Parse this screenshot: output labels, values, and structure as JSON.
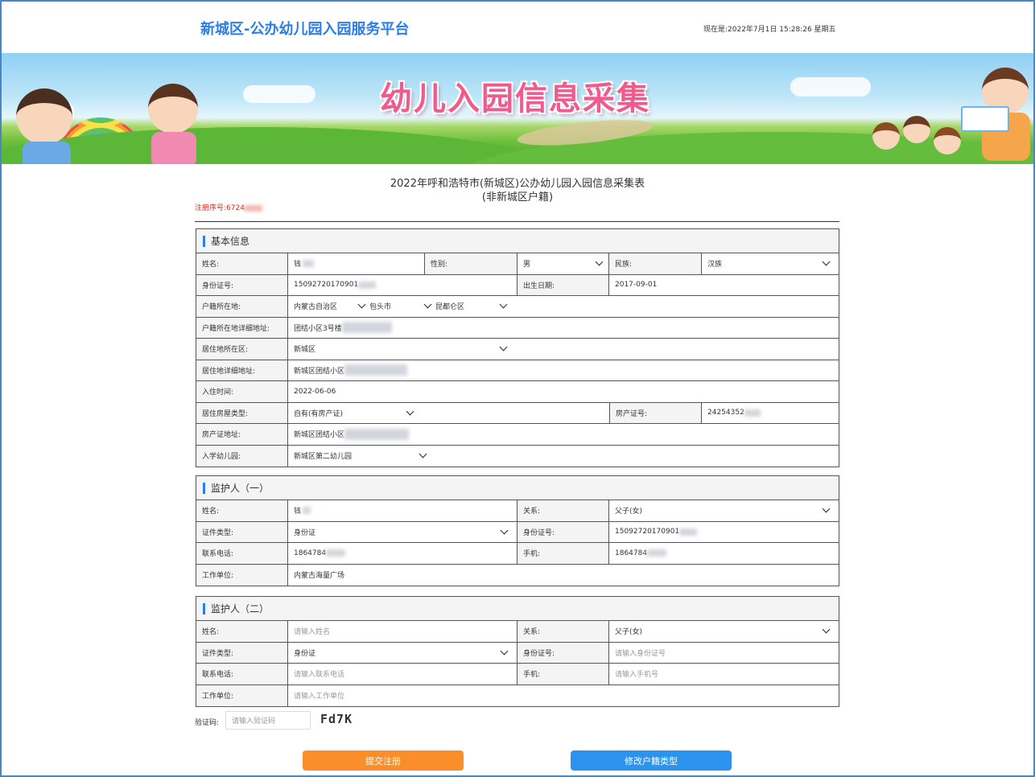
{
  "header": {
    "site_title": "新城区-公办幼儿园入园服务平台",
    "clock": "现在是:2022年7月1日 15:28:26 星期五"
  },
  "banner": {
    "title": "幼儿入园信息采集"
  },
  "form": {
    "title_line1": "2022年呼和浩特市(新城区)公办幼儿园入园信息采集表",
    "title_line2": "(非新城区户籍)",
    "reg_label": "注册序号:6724"
  },
  "basic": {
    "heading": "基本信息",
    "name_label": "姓名:",
    "name_value": "钱",
    "gender_label": "性别:",
    "gender_value": "男",
    "ethnic_label": "民族:",
    "ethnic_value": "汉族",
    "id_label": "身份证号:",
    "id_value": "15092720170901",
    "birth_label": "出生日期:",
    "birth_value": "2017-09-01",
    "hukou_label": "户籍所在地:",
    "hukou_province": "内蒙古自治区",
    "hukou_city": "包头市",
    "hukou_district": "昆都仑区",
    "hukou_addr_label": "户籍所在地详细地址:",
    "hukou_addr_value": "团结小区3号楼",
    "resid_district_label": "居住地所在区:",
    "resid_district_value": "新城区",
    "resid_addr_label": "居住地详细地址:",
    "resid_addr_value": "新城区团结小区",
    "movein_label": "入住时间:",
    "movein_value": "2022-06-06",
    "house_type_label": "居住房屋类型:",
    "house_type_value": "自有(有房产证)",
    "deed_no_label": "房产证号:",
    "deed_no_value": "24254352",
    "deed_addr_label": "房产证地址:",
    "deed_addr_value": "新城区团结小区",
    "kinder_label": "入学幼儿园:",
    "kinder_value": "新城区第二幼儿园"
  },
  "guardian1": {
    "heading": "监护人（一）",
    "name_label": "姓名:",
    "name_value": "钱",
    "relation_label": "关系:",
    "relation_value": "父子(女)",
    "idtype_label": "证件类型:",
    "idtype_value": "身份证",
    "id_label": "身份证号:",
    "id_value": "15092720170901",
    "phone_label": "联系电话:",
    "phone_value": "1864784",
    "mobile_label": "手机:",
    "mobile_value": "1864784",
    "work_label": "工作单位:",
    "work_value": "内蒙古海量广场"
  },
  "guardian2": {
    "heading": "监护人（二）",
    "name_label": "姓名:",
    "name_placeholder": "请输入姓名",
    "relation_label": "关系:",
    "relation_value": "父子(女)",
    "idtype_label": "证件类型:",
    "idtype_value": "身份证",
    "id_label": "身份证号:",
    "id_placeholder": "请输入身份证号",
    "phone_label": "联系电话:",
    "phone_placeholder": "请输入联系电话",
    "mobile_label": "手机:",
    "mobile_placeholder": "请输入手机号",
    "work_label": "工作单位:",
    "work_placeholder": "请输入工作单位"
  },
  "captcha": {
    "label": "验证码:",
    "placeholder": "请输入验证码",
    "code": "Fd7K"
  },
  "buttons": {
    "submit": "提交注册",
    "change": "修改户籍类型"
  },
  "colors": {
    "title_blue": "#2b7de9",
    "submit_orange": "#fa8e2a",
    "change_blue": "#2b93ee",
    "regno_red": "#e2261c"
  }
}
